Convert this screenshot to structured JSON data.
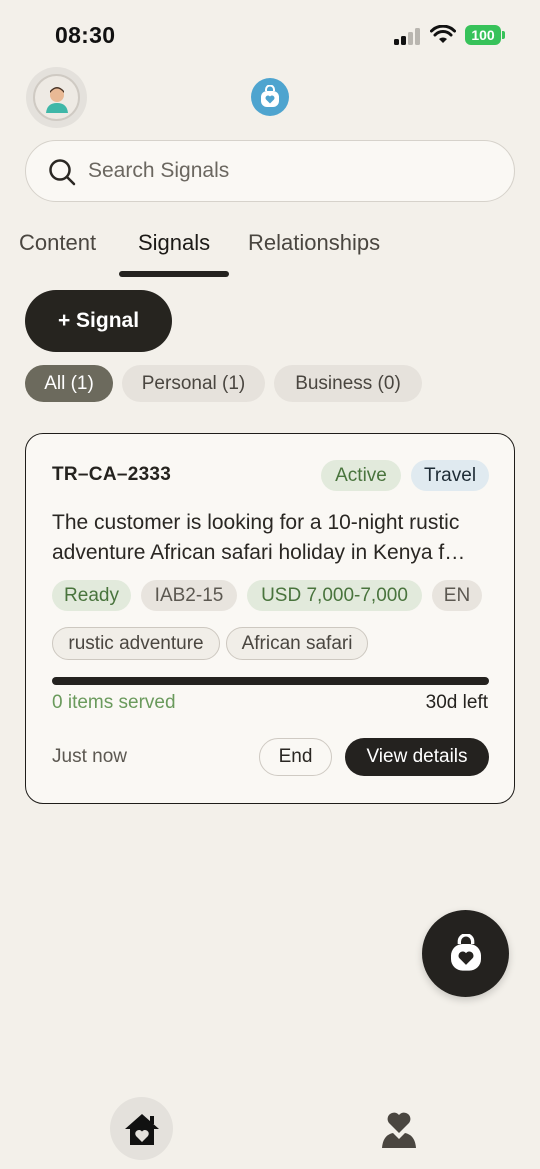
{
  "status_bar": {
    "time": "08:30",
    "battery": "100"
  },
  "search": {
    "placeholder": "Search Signals"
  },
  "tabs": [
    {
      "label": "Content"
    },
    {
      "label": "Signals",
      "active": true
    },
    {
      "label": "Relationships"
    }
  ],
  "add_signal_label": "+ Signal",
  "filters": [
    {
      "label": "All (1)",
      "active": true
    },
    {
      "label": "Personal (1)"
    },
    {
      "label": "Business (0)"
    }
  ],
  "card": {
    "id": "TR–CA–2333",
    "status": "Active",
    "category": "Travel",
    "description": "The customer is looking for a 10-night rustic adventure African safari holiday in Kenya f…",
    "pills": [
      "Ready",
      "IAB2-15",
      "USD 7,000-7,000",
      "EN"
    ],
    "tags": [
      "rustic adventure",
      "African safari"
    ],
    "progress": 1.0,
    "served": "0 items served",
    "remaining": "30d left",
    "time": "Just now",
    "end_label": "End",
    "details_label": "View details"
  },
  "colors": {
    "background": "#f3f0ea",
    "dark": "#24221f",
    "accent_blue": "#4ea4cf",
    "status_green": "#49743d",
    "battery_green": "#37c25a"
  },
  "icons": {
    "avatar": "avatar-icon",
    "logo": "heart-bag-icon",
    "search": "search-icon",
    "fab": "heart-bag-icon",
    "nav_home": "home-heart-icon",
    "nav_profile": "profile-heart-icon"
  }
}
